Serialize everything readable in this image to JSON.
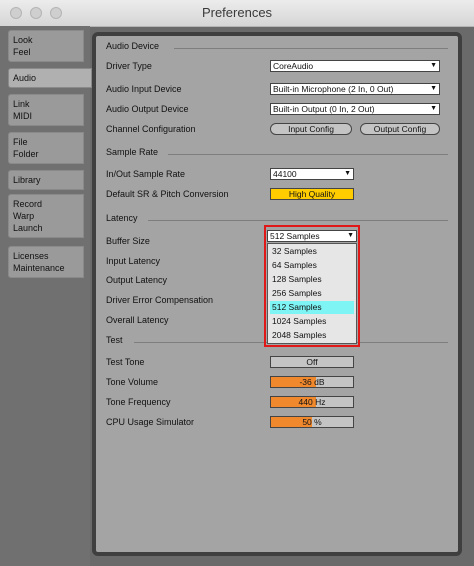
{
  "window": {
    "title": "Preferences"
  },
  "sidebar": {
    "tabs": [
      {
        "lines": [
          "Look",
          "Feel"
        ]
      },
      {
        "lines": [
          "Audio"
        ]
      },
      {
        "lines": [
          "Link",
          "MIDI"
        ]
      },
      {
        "lines": [
          "File",
          "Folder"
        ]
      },
      {
        "lines": [
          "Library"
        ]
      },
      {
        "lines": [
          "Record",
          "Warp",
          "Launch"
        ]
      },
      {
        "lines": [
          "Licenses",
          "Maintenance"
        ]
      }
    ],
    "active": "Audio"
  },
  "audio_device": {
    "header": "Audio Device",
    "driver_type_label": "Driver Type",
    "driver_type_value": "CoreAudio",
    "input_device_label": "Audio Input Device",
    "input_device_value": "Built-in Microphone (2 In, 0 Out)",
    "output_device_label": "Audio Output Device",
    "output_device_value": "Built-in Output (0 In, 2 Out)",
    "channel_config_label": "Channel Configuration",
    "input_config_button": "Input Config",
    "output_config_button": "Output Config"
  },
  "sample_rate": {
    "header": "Sample Rate",
    "inout_label": "In/Out Sample Rate",
    "inout_value": "44100",
    "default_sr_label": "Default SR & Pitch Conversion",
    "default_sr_value": "High Quality"
  },
  "latency": {
    "header": "Latency",
    "buffer_size_label": "Buffer Size",
    "buffer_size_value": "512 Samples",
    "input_latency_label": "Input Latency",
    "output_latency_label": "Output Latency",
    "driver_error_label": "Driver Error Compensation",
    "overall_latency_label": "Overall Latency",
    "dropdown_options": [
      "32 Samples",
      "64 Samples",
      "128 Samples",
      "256 Samples",
      "512 Samples",
      "1024 Samples",
      "2048 Samples"
    ],
    "dropdown_selected": "512 Samples"
  },
  "test": {
    "header": "Test",
    "test_tone_label": "Test Tone",
    "test_tone_value": "Off",
    "tone_volume_label": "Tone Volume",
    "tone_volume_value": "-36 dB",
    "tone_volume_fill": 0.55,
    "tone_frequency_label": "Tone Frequency",
    "tone_frequency_value": "440 Hz",
    "tone_frequency_fill": 0.55,
    "cpu_sim_label": "CPU Usage Simulator",
    "cpu_sim_value": "50 %",
    "cpu_sim_fill": 0.5
  },
  "colors": {
    "accent_orange": "#f0892e",
    "yellow": "#ffcc00",
    "highlight": "#7ef4f4",
    "callout_red": "#e01818"
  }
}
